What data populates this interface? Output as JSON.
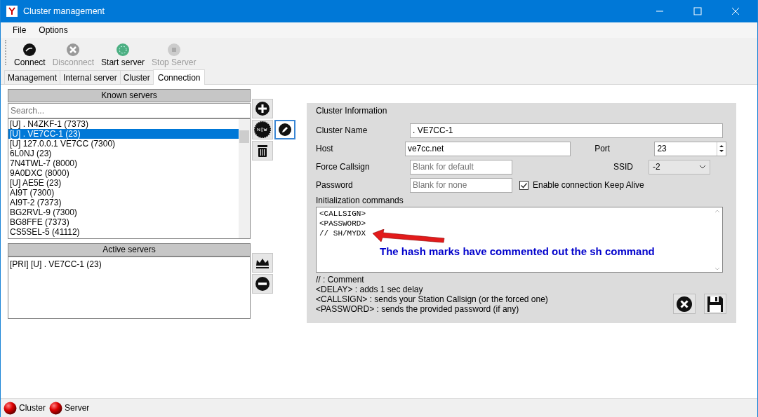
{
  "window": {
    "title": "Cluster management"
  },
  "menu": [
    "File",
    "Options"
  ],
  "toolbar": [
    {
      "kind": "connect",
      "label": "Connect",
      "disabled": false
    },
    {
      "kind": "disconnect",
      "label": "Disconnect",
      "disabled": true
    },
    {
      "kind": "start",
      "label": "Start server",
      "disabled": false
    },
    {
      "kind": "stop",
      "label": "Stop Server",
      "disabled": true
    }
  ],
  "tabs": [
    {
      "label": "Management",
      "selected": false
    },
    {
      "label": "Internal server",
      "selected": false
    },
    {
      "label": "Cluster",
      "selected": false
    },
    {
      "label": "Connection",
      "selected": true
    }
  ],
  "known_servers": {
    "title": "Known servers",
    "search": {
      "placeholder": "Search..."
    },
    "items": [
      {
        "label": "[U] . N4ZKF-1 (7373)",
        "selected": false
      },
      {
        "label": "[U] . VE7CC-1 (23)",
        "selected": true
      },
      {
        "label": "[U] 127.0.0.1 VE7CC (7300)",
        "selected": false
      },
      {
        "label": "6L0NJ (23)",
        "selected": false
      },
      {
        "label": "7N4TWL-7 (8000)",
        "selected": false
      },
      {
        "label": "9A0DXC (8000)",
        "selected": false
      },
      {
        "label": "[U] AE5E (23)",
        "selected": false
      },
      {
        "label": "AI9T (7300)",
        "selected": false
      },
      {
        "label": "AI9T-2 (7373)",
        "selected": false
      },
      {
        "label": "BG2RVL-9 (7300)",
        "selected": false
      },
      {
        "label": "BG8FFE (7373)",
        "selected": false
      },
      {
        "label": "CS5SEL-5 (41112)",
        "selected": false
      }
    ]
  },
  "active_servers": {
    "title": "Active servers",
    "items": [
      "[PRI] [U] . VE7CC-1 (23)"
    ]
  },
  "cluster_info": {
    "title": "Cluster Information",
    "cluster_name": {
      "label": "Cluster Name",
      "value": ". VE7CC-1"
    },
    "host": {
      "label": "Host",
      "value": "ve7cc.net"
    },
    "port": {
      "label": "Port",
      "value": "23"
    },
    "force_callsign": {
      "label": "Force Callsign",
      "placeholder": "Blank for default"
    },
    "ssid": {
      "label": "SSID",
      "value": "-2"
    },
    "password": {
      "label": "Password",
      "placeholder": "Blank for none"
    },
    "keep_alive": {
      "label": "Enable connection Keep Alive",
      "checked": true
    },
    "init_commands": {
      "label": "Initialization commands",
      "lines": [
        "<CALLSIGN>",
        "<PASSWORD>",
        "// SH/MYDX"
      ]
    },
    "annotation": "The hash marks have commented out the sh command",
    "help": [
      "// : Comment",
      "<DELAY> : adds 1 sec delay",
      "<CALLSIGN> : sends your Station Callsign (or the forced one)",
      "<PASSWORD> : sends the provided password (if any)"
    ]
  },
  "status_bar": [
    {
      "label": "Cluster"
    },
    {
      "label": "Server"
    }
  ]
}
